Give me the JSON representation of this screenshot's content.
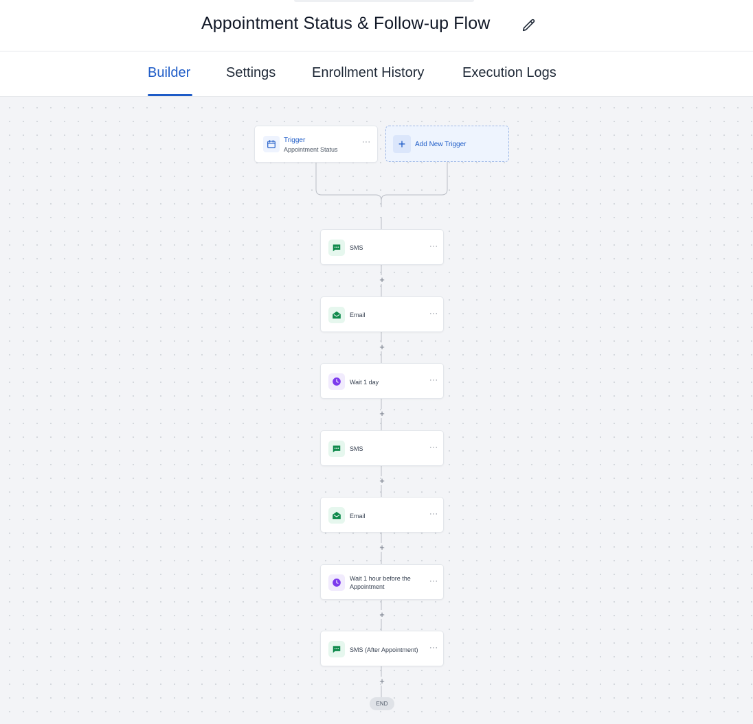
{
  "header": {
    "title": "Appointment Status & Follow-up Flow"
  },
  "tabs": [
    {
      "label": "Builder",
      "active": true
    },
    {
      "label": "Settings",
      "active": false
    },
    {
      "label": "Enrollment History",
      "active": false
    },
    {
      "label": "Execution Logs",
      "active": false
    }
  ],
  "trigger": {
    "label": "Trigger",
    "subtitle": "Appointment Status",
    "icon": "calendar-icon",
    "menu": "···"
  },
  "add_trigger": {
    "label": "Add New Trigger",
    "icon": "plus-icon"
  },
  "actions": [
    {
      "label": "SMS",
      "icon": "chat-icon",
      "menu": "···"
    },
    {
      "label": "Email",
      "icon": "mail-open-icon",
      "menu": "···"
    },
    {
      "label": "Wait 1 day",
      "icon": "clock-icon",
      "menu": "···"
    },
    {
      "label": "SMS",
      "icon": "chat-icon",
      "menu": "···"
    },
    {
      "label": "Email",
      "icon": "mail-open-icon",
      "menu": "···"
    },
    {
      "label": "Wait 1 hour before the Appointment",
      "icon": "clock-icon",
      "menu": "···"
    },
    {
      "label": "SMS (After Appointment)",
      "icon": "chat-icon",
      "menu": "···"
    }
  ],
  "end_label": "END",
  "colors": {
    "accent": "#1d5bc7",
    "sms_email_icon": "#0f8a4c",
    "wait_icon": "#7c3aed",
    "canvas": "#f3f4f7"
  }
}
